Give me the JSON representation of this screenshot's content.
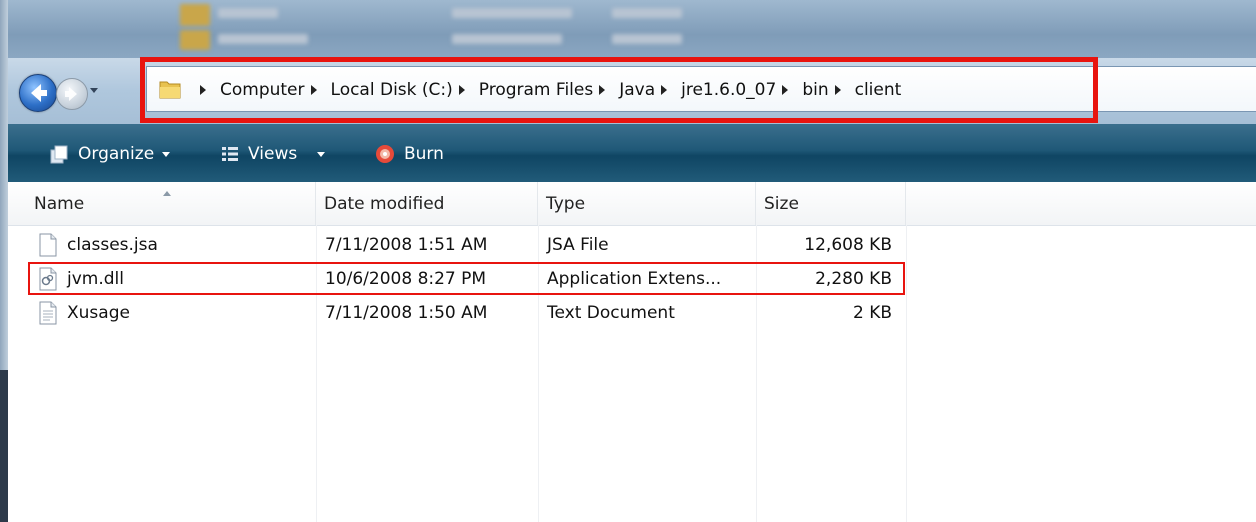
{
  "breadcrumb": [
    "Computer",
    "Local Disk (C:)",
    "Program Files",
    "Java",
    "jre1.6.0_07",
    "bin",
    "client"
  ],
  "toolbar": {
    "organize_label": "Organize",
    "views_label": "Views",
    "burn_label": "Burn"
  },
  "columns": {
    "name": "Name",
    "date_modified": "Date modified",
    "type": "Type",
    "size": "Size"
  },
  "files": [
    {
      "name": "classes.jsa",
      "date_modified": "7/11/2008 1:51 AM",
      "type": "JSA File",
      "size": "12,608 KB",
      "icon": "file-icon"
    },
    {
      "name": "jvm.dll",
      "date_modified": "10/6/2008 8:27 PM",
      "type": "Application Extens...",
      "size": "2,280 KB",
      "icon": "dll-icon"
    },
    {
      "name": "Xusage",
      "date_modified": "7/11/2008 1:50 AM",
      "type": "Text Document",
      "size": "2 KB",
      "icon": "text-file-icon"
    }
  ],
  "colors": {
    "highlight": "#e8140f",
    "toolbar": "#1f5877"
  }
}
